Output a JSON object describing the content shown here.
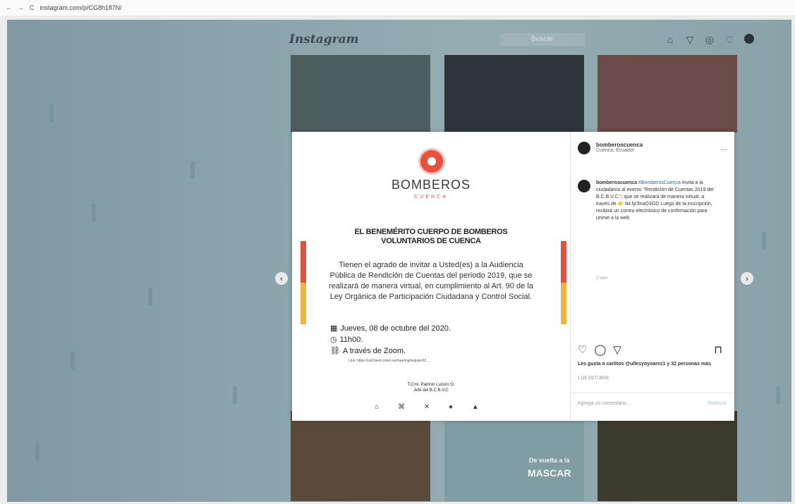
{
  "browser": {
    "back": "←",
    "forward": "→",
    "reload": "C",
    "url": "instagram.com/p/CG8h1fl7N/"
  },
  "ig": {
    "logo": "Instagram",
    "search_placeholder": "Buscar",
    "nav_icons": [
      "home-icon",
      "direct-icon",
      "explore-icon",
      "heart-icon",
      "avatar"
    ]
  },
  "tiles": {
    "bottom_middle_text1": "De vuelta a la",
    "bottom_middle_text2": "MASCAR"
  },
  "post": {
    "brand": "BOMBEROS",
    "brand_sub": "CUENCA",
    "headline": "EL BENEMÉRITO CUERPO DE BOMBEROS VOLUNTARIOS DE CUENCA",
    "invite": "Tienen el agrado de invitar a Usted(es) a la Audiencia Pública de Rendición de Cuentas del periodo 2019, que se realizará de manera virtual, en cumplimiento al Art. 90 de la Ley Orgánica de Participación Ciudadana y Control Social.",
    "date": "Jueves, 08 de octubre del 2020.",
    "time": "11h00.",
    "via": "A través de Zoom.",
    "zoom_link": "Link: https://us02web.zoom.us/meeting/register/tZ...",
    "signer": "T.Crnl. Patricio Luzuro O.",
    "signer_title": "Jefe del B.C.B.V.C",
    "mini_logos": "⌂ ⌘ ✕ ● ▲"
  },
  "side": {
    "account": "bomberoscuenca",
    "location": "Cuenca, Ecuador",
    "more": "…",
    "caption_user": "bomberoscuenca",
    "caption_tag": "#BomberosCuenca",
    "caption": "Invita a la ciudadanía al evento \"Rendición de Cuentas 2019 del B.C.B.V.C.\", que se realizará de manera virtual, a través de 👉 bit.ly/3naO3GD Luego de la inscripción, recibirá un correo electrónico de confirmación para unirse a la web",
    "caption_time": "2 sem",
    "likes": "Les gusta a carlitos @ullesyoyoarez1 y 32 personas más",
    "post_date": "1 DE OCTUBRE",
    "comment_placeholder": "Agrega un comentario...",
    "publish": "Publicar"
  },
  "colors": {
    "accent_red": "#e2503f",
    "accent_yellow": "#f0b340",
    "overlay": "#8aa4ac"
  }
}
